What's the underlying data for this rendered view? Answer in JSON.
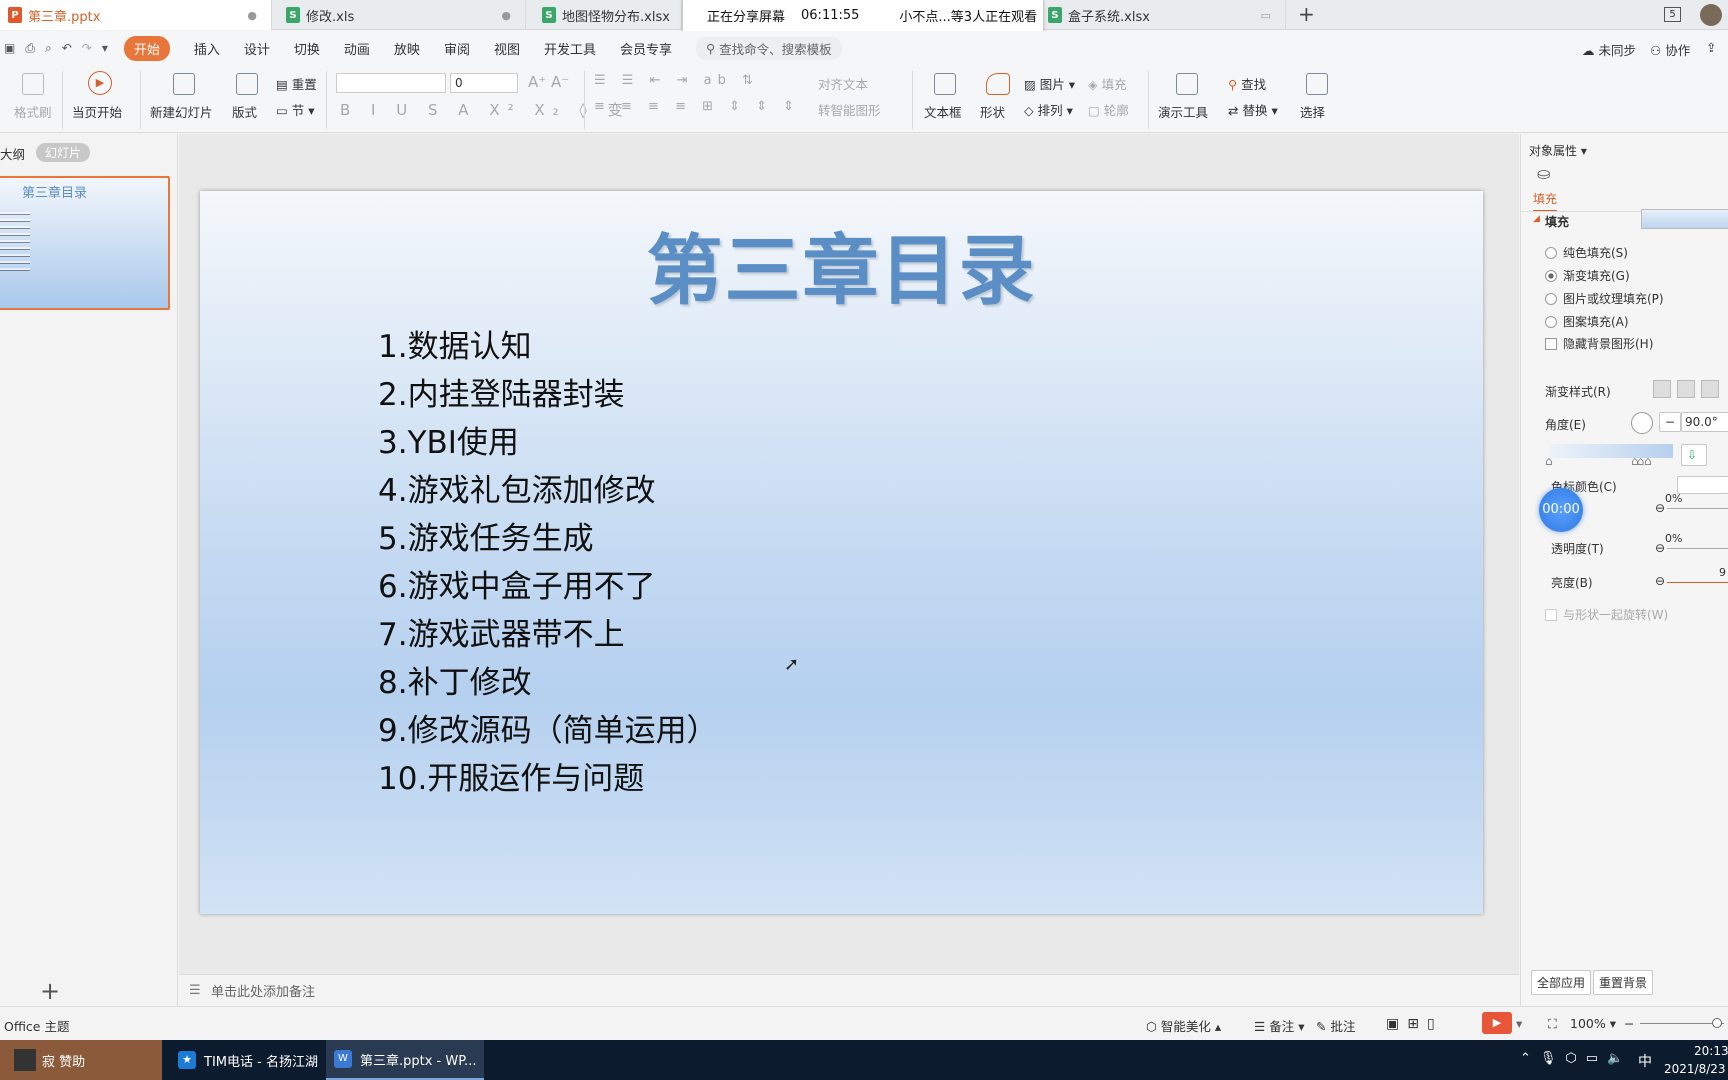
{
  "tabs": [
    {
      "label": "第三章.pptx",
      "type": "ppt",
      "active": true
    },
    {
      "label": "修改.xls",
      "type": "xls"
    },
    {
      "label": "地图怪物分布.xlsx",
      "type": "xlsx"
    },
    {
      "label": "盒子系统.xlsx",
      "type": "xlsx"
    }
  ],
  "tab_count": "5",
  "share": {
    "status": "正在分享屏幕",
    "time": "06:11:55",
    "viewers": "小不点...等3人正在观看"
  },
  "menu": [
    "开始",
    "插入",
    "设计",
    "切换",
    "动画",
    "放映",
    "审阅",
    "视图",
    "开发工具",
    "会员专享"
  ],
  "search_placeholder": "查找命令、搜索模板",
  "top_right": {
    "sync": "未同步",
    "collab": "协作"
  },
  "ribbon": {
    "format_painter": "格式刷",
    "from_current": "当页开始",
    "new_slide": "新建幻灯片",
    "layout": "版式",
    "reset": "重置",
    "section": "节",
    "font_size": "0",
    "align_text": "对齐文本",
    "smart_art": "转智能图形",
    "textbox": "文本框",
    "shape": "形状",
    "picture": "图片",
    "fill": "填充",
    "arrange": "排列",
    "outline": "轮廓",
    "present_tools": "演示工具",
    "find": "查找",
    "replace": "替换",
    "select": "选择"
  },
  "leftpanel": {
    "outline_tab": "大纲",
    "slides_tab": "幻灯片",
    "thumb_title": "第三章目录"
  },
  "slide": {
    "title": "第三章目录",
    "items": [
      "1.数据认知",
      "2.内挂登陆器封装",
      "3.YBI使用",
      "4.游戏礼包添加修改",
      "5.游戏任务生成",
      "6.游戏中盒子用不了",
      "7.游戏武器带不上",
      "8.补丁修改",
      "9.修改源码（简单运用）",
      "10.开服运作与问题"
    ]
  },
  "notes_placeholder": "单击此处添加备注",
  "rightpanel": {
    "header": "对象属性",
    "tab_fill": "填充",
    "section_fill": "填充",
    "opt_solid": "纯色填充(S)",
    "opt_gradient": "渐变填充(G)",
    "opt_picture": "图片或纹理填充(P)",
    "opt_pattern": "图案填充(A)",
    "opt_hide_bg": "隐藏背景图形(H)",
    "gradient_style": "渐变样式(R)",
    "angle": "角度(E)",
    "angle_value": "90.0°",
    "stop_color": "色标颜色(C)",
    "position_pct": "0%",
    "transparency": "透明度(T)",
    "transparency_pct": "0%",
    "brightness": "亮度(B)",
    "brightness_val": "9",
    "rotate_with_shape": "与形状一起旋转(W)",
    "apply_all": "全部应用",
    "reset_bg": "重置背景",
    "timer": "00:00"
  },
  "statusbar": {
    "theme": "Office 主题",
    "beautify": "智能美化",
    "notes": "备注",
    "comment": "批注",
    "zoom": "100%"
  },
  "taskbar": {
    "start_user": "寂 赞助",
    "app1": "TIM电话 - 名扬江湖",
    "app2": "第三章.pptx - WP...",
    "ime": "中",
    "time": "20:13",
    "date": "2021/8/23"
  },
  "colors": {
    "accent": "#e8763a",
    "title_blue": "#5b8ec5",
    "taskbar": "#0d1b2e"
  }
}
